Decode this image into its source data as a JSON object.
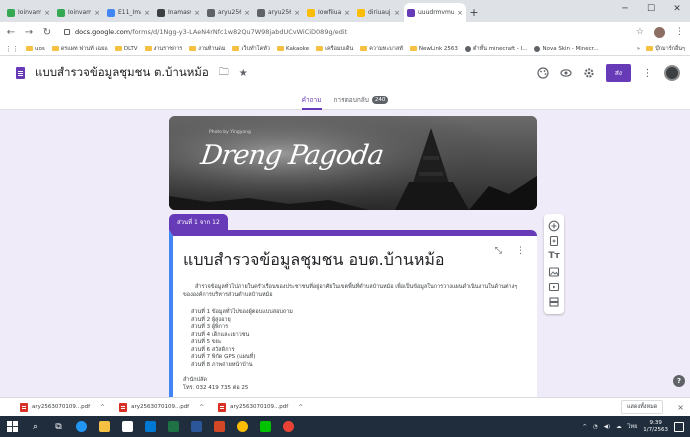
{
  "browser": {
    "tabs": [
      {
        "label": "Ioinvamaurr",
        "color": "#34a853"
      },
      {
        "label": "Ioinvamaurr",
        "color": "#34a853"
      },
      {
        "label": "E11_Imamr",
        "color": "#4285f4"
      },
      {
        "label": "Inamaswanu",
        "color": "#3c4043"
      },
      {
        "label": "aryu25630701",
        "color": "#5f6368"
      },
      {
        "label": "aryu25630701",
        "color": "#5f6368"
      },
      {
        "label": "Iowfiiuaiu",
        "color": "#fbbc04"
      },
      {
        "label": "diriuaujmgu",
        "color": "#fbbc04"
      },
      {
        "label": "uuudrmvmu",
        "color": "#673ab7"
      }
    ],
    "new_tab": "+",
    "url_host": "docs.google.com",
    "url_path": "/forms/d/1Ngg-y3-LAeN4rNfc1w82Qu7W98jabdUCvWiCiD089g/edit",
    "bookmarks": [
      "uos",
      "ดรแผท ฟานท้ เฉยแ",
      "DLTV",
      "งานราชการ",
      "งานท้านดม",
      "เว็บทำโคทัว",
      "Kakaoke",
      "เครือมบเดิน",
      "ความทะบาลทั",
      "NewLink 2563",
      "ตำทั้น minecraft - I...",
      "Nova Skin - Minecr..."
    ],
    "bookmarks_more": "»",
    "bookmarks_other": "บุ๊กมาร์กอื่นๆ"
  },
  "form": {
    "doc_title": "แบบสำรวจข้อมูลชุมชน ต.บ้านหม้อ",
    "send_label": "ส่ง",
    "tabs": {
      "questions": "คำถาม",
      "responses": "การตอบกลับ",
      "responses_count": "240"
    },
    "banner": {
      "credit": "Photo by Yingyong",
      "script": "Dreng Pagoda"
    },
    "section_label": "ส่วนที่ 1 จาก 12",
    "title": "แบบสำรวจข้อมูลชุมชน อบต.บ้านหม้อ",
    "description": "สำรวจข้อมูลทั่วไปภายในครัวเรือนของประชาชนที่อยู่อาศัยในเขตพื้นที่ตำบลบ้านหม้อ เพื่อเป็นข้อมูลในการวางแผนดำเนินงานในด้านต่างๆ ขององค์การบริหารส่วนตำบลบ้านหม้อ",
    "sections": [
      "ส่วนที่ 1  ข้อมูลทั่วไปของผู้ตอบแบบสอบถาม",
      "ส่วนที่ 2  ผู้สูงอายุ",
      "ส่วนที่ 3  ผู้พิการ",
      "ส่วนที่ 4  เด็กและเยาวชน",
      "ส่วนที่ 5  ขยะ",
      "ส่วนที่ 6  สวัสดิการ",
      "ส่วนที่ 7  พิกัด GPS (แผนที่)",
      "ส่วนที่ 8  ภาพถ่ายหน้าบ้าน"
    ],
    "office_label": "สำนักปลัด",
    "office_phone": "โทร. 032 419 735 ต่อ 25"
  },
  "downloads": {
    "items": [
      "ary2563070109...pdf",
      "ary2563070109...pdf",
      "ary2563070109...pdf"
    ],
    "show_all": "แสดงทั้งหมด"
  },
  "taskbar": {
    "time": "9:39",
    "date": "1/7/2563",
    "lang": "ไทย"
  },
  "colors": {
    "accent": "#673ab7",
    "section_border": "#4285f4",
    "page_bg": "#f0ebf8"
  }
}
